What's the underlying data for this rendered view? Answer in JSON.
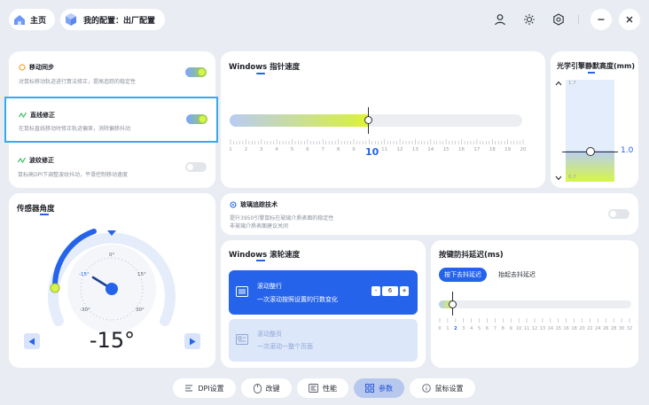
{
  "header": {
    "home_label": "主页",
    "config_label": "我的配置：出厂配置"
  },
  "motion_sync": {
    "title": "移动同步",
    "desc": "对鼠标移动轨迹进行算法修正，提高追踪的稳定性",
    "enabled": true
  },
  "line_correction": {
    "title": "直线修正",
    "desc": "在鼠标直线移动时修正轨迹偏差，消除偏移抖动",
    "enabled": true
  },
  "ripple_correction": {
    "title": "波纹修正",
    "desc": "鼠标高DPI下调整波纹抖动，平滑控制移动速度",
    "enabled": false
  },
  "pointer_speed": {
    "title": "Windows 指针速度",
    "value": "10",
    "fraction": 0.5,
    "ticks": [
      "1",
      "2",
      "3",
      "4",
      "5",
      "6",
      "7",
      "8",
      "9",
      "10",
      "11",
      "12",
      "13",
      "14",
      "15",
      "16",
      "17",
      "18",
      "19",
      "20"
    ]
  },
  "lod": {
    "title": "光学引擎静默高度(mm)",
    "max": "1.7",
    "min": "0.7",
    "value": "1.0"
  },
  "sensor_angle": {
    "title": "传感器角度",
    "value": "-15°",
    "labels": {
      "top": "0°",
      "left": "-15°",
      "right": "15°",
      "bottom_left": "-30°",
      "bottom_right": "30°"
    }
  },
  "glass_tracking": {
    "title": "玻璃追踪技术",
    "desc1": "提升3950引擎鼠标在玻璃介质表面的稳定性",
    "desc2": "非玻璃介质表面建议关闭",
    "enabled": false
  },
  "scroll_speed": {
    "title": "Windows 滚轮速度",
    "option1_title": "滚动整行",
    "option1_desc": "一次滚动按照设置的行数变化",
    "stepper_minus": "-",
    "stepper_value": "6",
    "stepper_plus": "+",
    "option2_title": "滚动整页",
    "option2_desc": "一次滚动一整个页面"
  },
  "debounce": {
    "title": "按键防抖延迟(ms)",
    "tab_press": "按下去抖延迟",
    "tab_release": "抬起去抖延迟",
    "value": "2",
    "ticks": [
      "0",
      "1",
      "2",
      "3",
      "4",
      "5",
      "6",
      "7",
      "8",
      "9",
      "10",
      "11",
      "12",
      "13",
      "14",
      "15",
      "16",
      "18",
      "20",
      "22",
      "24",
      "26",
      "28",
      "30",
      "32"
    ]
  },
  "bottom_nav": {
    "dpi": "DPI设置",
    "keys": "改键",
    "performance": "性能",
    "params": "参数",
    "mouse_settings": "鼠标设置"
  },
  "colors": {
    "accent_blue": "#2563eb",
    "lime": "#d6f54a",
    "selection_border": "#37a9ee"
  }
}
